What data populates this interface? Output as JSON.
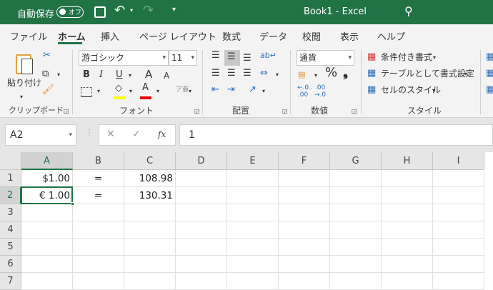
{
  "titlebar": {
    "autosave_label": "自動保存",
    "autosave_state": "オフ",
    "title": "Book1  -  Excel"
  },
  "tabs": [
    "ファイル",
    "ホーム",
    "挿入",
    "ページ レイアウト",
    "数式",
    "データ",
    "校閲",
    "表示",
    "ヘルプ"
  ],
  "active_tab": "ホーム",
  "ribbon": {
    "clipboard": {
      "paste": "貼り付け",
      "label": "クリップボード"
    },
    "font": {
      "name": "游ゴシック",
      "size": "11",
      "bold": "B",
      "italic": "I",
      "underline": "U",
      "grow": "A",
      "shrink": "A",
      "label": "フォント",
      "font_color": "#e00000",
      "fill_color": "#ffff00"
    },
    "alignment": {
      "label": "配置"
    },
    "number": {
      "format": "通貨",
      "percent": "%",
      "comma": "❟",
      "label": "数値"
    },
    "styles": {
      "conditional": "条件付き書式",
      "table": "テーブルとして書式設定",
      "cell_styles": "セルのスタイル",
      "label": "スタイル"
    }
  },
  "formula_bar": {
    "name_box": "A2",
    "fx": "fx",
    "value": "1"
  },
  "columns": [
    "A",
    "B",
    "C",
    "D",
    "E",
    "F",
    "G",
    "H",
    "I"
  ],
  "rows": [
    "1",
    "2",
    "3",
    "4",
    "5",
    "6",
    "7"
  ],
  "cells": [
    {
      "A": "$1.00",
      "B": "=",
      "C": "108.98"
    },
    {
      "A": "€ 1.00",
      "B": "=",
      "C": "130.31"
    }
  ],
  "selected_cell": "A2",
  "colors": {
    "brand": "#217346"
  }
}
